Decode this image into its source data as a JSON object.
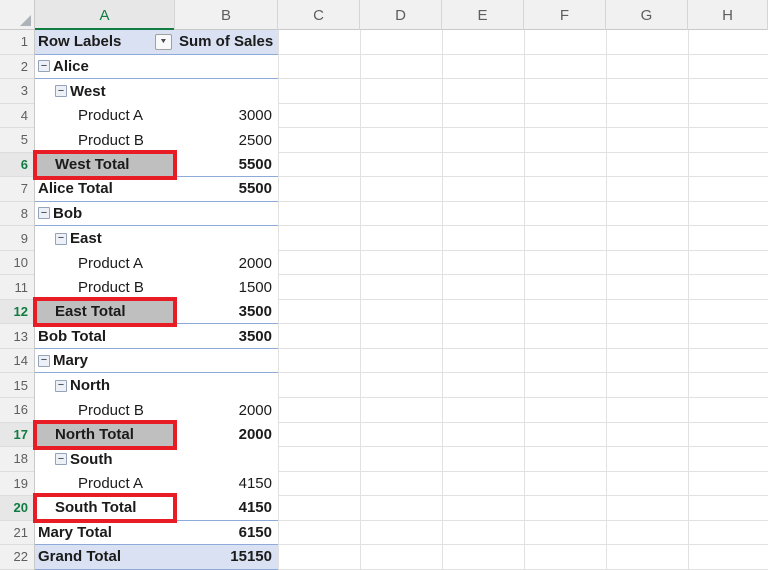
{
  "sheet": {
    "column_headers": [
      "A",
      "B",
      "C",
      "D",
      "E",
      "F",
      "G",
      "H"
    ],
    "selected_column": "A",
    "selected_rows": [
      6,
      12,
      17,
      20
    ],
    "row_count": 22,
    "header": {
      "row_labels": "Row Labels",
      "values_label": "Sum of Sales"
    },
    "icons": {
      "collapse_glyph": "−",
      "filter_arrow_glyph": "▼"
    },
    "pivot_rows": [
      {
        "row": 2,
        "label": "Alice",
        "level": 0,
        "collapse": true,
        "bold": true,
        "value": "",
        "sep": true,
        "gray": false,
        "red_box": false,
        "grand": false
      },
      {
        "row": 3,
        "label": "West",
        "level": 1,
        "collapse": true,
        "bold": true,
        "value": "",
        "sep": false,
        "gray": false,
        "red_box": false,
        "grand": false
      },
      {
        "row": 4,
        "label": "Product A",
        "level": 2,
        "collapse": false,
        "bold": false,
        "value": "3000",
        "sep": false,
        "gray": false,
        "red_box": false,
        "grand": false
      },
      {
        "row": 5,
        "label": "Product B",
        "level": 2,
        "collapse": false,
        "bold": false,
        "value": "2500",
        "sep": false,
        "gray": false,
        "red_box": false,
        "grand": false
      },
      {
        "row": 6,
        "label": "West Total",
        "level": 1,
        "collapse": false,
        "bold": true,
        "value": "5500",
        "sep": true,
        "gray": true,
        "red_box": true,
        "grand": false
      },
      {
        "row": 7,
        "label": "Alice Total",
        "level": 0,
        "collapse": false,
        "bold": true,
        "value": "5500",
        "sep": true,
        "gray": false,
        "red_box": false,
        "grand": false
      },
      {
        "row": 8,
        "label": "Bob",
        "level": 0,
        "collapse": true,
        "bold": true,
        "value": "",
        "sep": true,
        "gray": false,
        "red_box": false,
        "grand": false
      },
      {
        "row": 9,
        "label": "East",
        "level": 1,
        "collapse": true,
        "bold": true,
        "value": "",
        "sep": false,
        "gray": false,
        "red_box": false,
        "grand": false
      },
      {
        "row": 10,
        "label": "Product A",
        "level": 2,
        "collapse": false,
        "bold": false,
        "value": "2000",
        "sep": false,
        "gray": false,
        "red_box": false,
        "grand": false
      },
      {
        "row": 11,
        "label": "Product B",
        "level": 2,
        "collapse": false,
        "bold": false,
        "value": "1500",
        "sep": false,
        "gray": false,
        "red_box": false,
        "grand": false
      },
      {
        "row": 12,
        "label": "East Total",
        "level": 1,
        "collapse": false,
        "bold": true,
        "value": "3500",
        "sep": true,
        "gray": true,
        "red_box": true,
        "grand": false
      },
      {
        "row": 13,
        "label": "Bob Total",
        "level": 0,
        "collapse": false,
        "bold": true,
        "value": "3500",
        "sep": true,
        "gray": false,
        "red_box": false,
        "grand": false
      },
      {
        "row": 14,
        "label": "Mary",
        "level": 0,
        "collapse": true,
        "bold": true,
        "value": "",
        "sep": true,
        "gray": false,
        "red_box": false,
        "grand": false
      },
      {
        "row": 15,
        "label": "North",
        "level": 1,
        "collapse": true,
        "bold": true,
        "value": "",
        "sep": false,
        "gray": false,
        "red_box": false,
        "grand": false
      },
      {
        "row": 16,
        "label": "Product B",
        "level": 2,
        "collapse": false,
        "bold": false,
        "value": "2000",
        "sep": false,
        "gray": false,
        "red_box": false,
        "grand": false
      },
      {
        "row": 17,
        "label": "North Total",
        "level": 1,
        "collapse": false,
        "bold": true,
        "value": "2000",
        "sep": false,
        "gray": true,
        "red_box": true,
        "grand": false
      },
      {
        "row": 18,
        "label": "South",
        "level": 1,
        "collapse": true,
        "bold": true,
        "value": "",
        "sep": false,
        "gray": false,
        "red_box": false,
        "grand": false
      },
      {
        "row": 19,
        "label": "Product A",
        "level": 2,
        "collapse": false,
        "bold": false,
        "value": "4150",
        "sep": false,
        "gray": false,
        "red_box": false,
        "grand": false
      },
      {
        "row": 20,
        "label": "South Total",
        "level": 1,
        "collapse": false,
        "bold": true,
        "value": "4150",
        "sep": true,
        "gray": false,
        "red_box": true,
        "grand": false
      },
      {
        "row": 21,
        "label": "Mary Total",
        "level": 0,
        "collapse": false,
        "bold": true,
        "value": "6150",
        "sep": true,
        "gray": false,
        "red_box": false,
        "grand": false
      },
      {
        "row": 22,
        "label": "Grand Total",
        "level": 0,
        "collapse": false,
        "bold": true,
        "value": "15150",
        "sep": true,
        "gray": false,
        "red_box": false,
        "grand": true
      }
    ],
    "colors": {
      "header_fill": "#D9E1F2",
      "grand_total_fill": "#D9E1F2",
      "subtotal_highlight": "#BFBFBF",
      "annotation_red": "#E81C24",
      "pivot_border_blue": "#8EAADB",
      "selection_green": "#107C41",
      "gridline": "#E1E1E1",
      "heading_bg": "#F1F1F1",
      "heading_bg_selected": "#E7E7E7",
      "heading_border": "#C9C9C9",
      "heading_text": "#5E5E5E",
      "cell_text": "#1B1B1B"
    }
  }
}
